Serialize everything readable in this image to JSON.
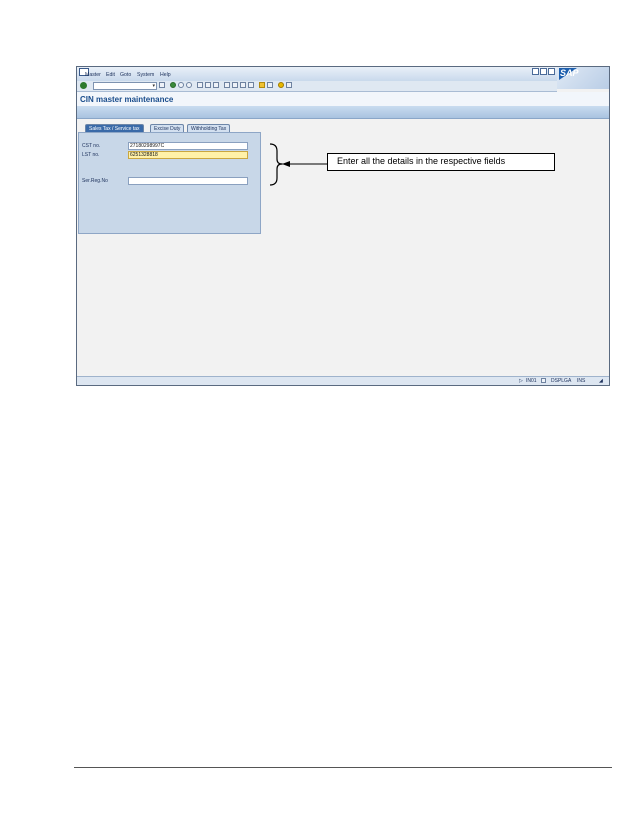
{
  "menu": {
    "items": [
      "Master",
      "Edit",
      "Goto",
      "System",
      "Help"
    ]
  },
  "logo": "SAP",
  "title": "CIN master maintenance",
  "tabs": [
    {
      "label": "Sales Tax / Service tax",
      "active": true
    },
    {
      "label": "Excise Duty",
      "active": false
    },
    {
      "label": "Withholding Tax",
      "active": false
    }
  ],
  "form": {
    "cst_label": "CST no.",
    "cst_value": "27180298997C",
    "lst_label": "LST no.",
    "lst_value": "6251328818",
    "ser_label": "Ser.Reg.No",
    "ser_value": ""
  },
  "status": {
    "session": "IN01",
    "system": "DSPLGA",
    "mode": "INS"
  },
  "callout": "Enter all the details in the respective fields",
  "colors": {
    "accent": "#1a4d8c",
    "focus_field": "#fff1a8",
    "panel": "#c8d7e8"
  },
  "icons": [
    "enter-icon",
    "back-icon",
    "exit-icon",
    "cancel-icon",
    "print-icon",
    "find-icon",
    "help-icon",
    "layout-icon"
  ]
}
